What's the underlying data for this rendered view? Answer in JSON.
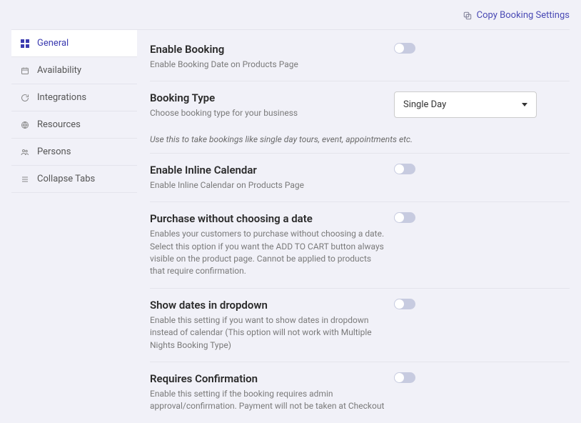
{
  "topbar": {
    "copy_label": "Copy Booking Settings"
  },
  "sidebar": {
    "items": [
      {
        "label": "General",
        "icon": "grid-icon"
      },
      {
        "label": "Availability",
        "icon": "calendar-icon"
      },
      {
        "label": "Integrations",
        "icon": "sync-icon"
      },
      {
        "label": "Resources",
        "icon": "globe-icon"
      },
      {
        "label": "Persons",
        "icon": "persons-icon"
      },
      {
        "label": "Collapse Tabs",
        "icon": "list-icon"
      }
    ]
  },
  "settings": {
    "enable_booking": {
      "title": "Enable Booking",
      "desc": "Enable Booking Date on Products Page"
    },
    "booking_type": {
      "title": "Booking Type",
      "desc": "Choose booking type for your business",
      "selected": "Single Day",
      "hint": "Use this to take bookings like single day tours, event, appointments etc."
    },
    "inline_calendar": {
      "title": "Enable Inline Calendar",
      "desc": "Enable Inline Calendar on Products Page"
    },
    "purchase_without_date": {
      "title": "Purchase without choosing a date",
      "desc": "Enables your customers to purchase without choosing a date. Select this option if you want the ADD TO CART button always visible on the product page. Cannot be applied to products that require confirmation."
    },
    "dates_dropdown": {
      "title": "Show dates in dropdown",
      "desc": "Enable this setting if you want to show dates in dropdown instead of calendar (This option will not work with Multiple Nights Booking Type)"
    },
    "requires_confirmation": {
      "title": "Requires Confirmation",
      "desc": "Enable this setting if the booking requires admin approval/confirmation. Payment will not be taken at Checkout"
    }
  }
}
